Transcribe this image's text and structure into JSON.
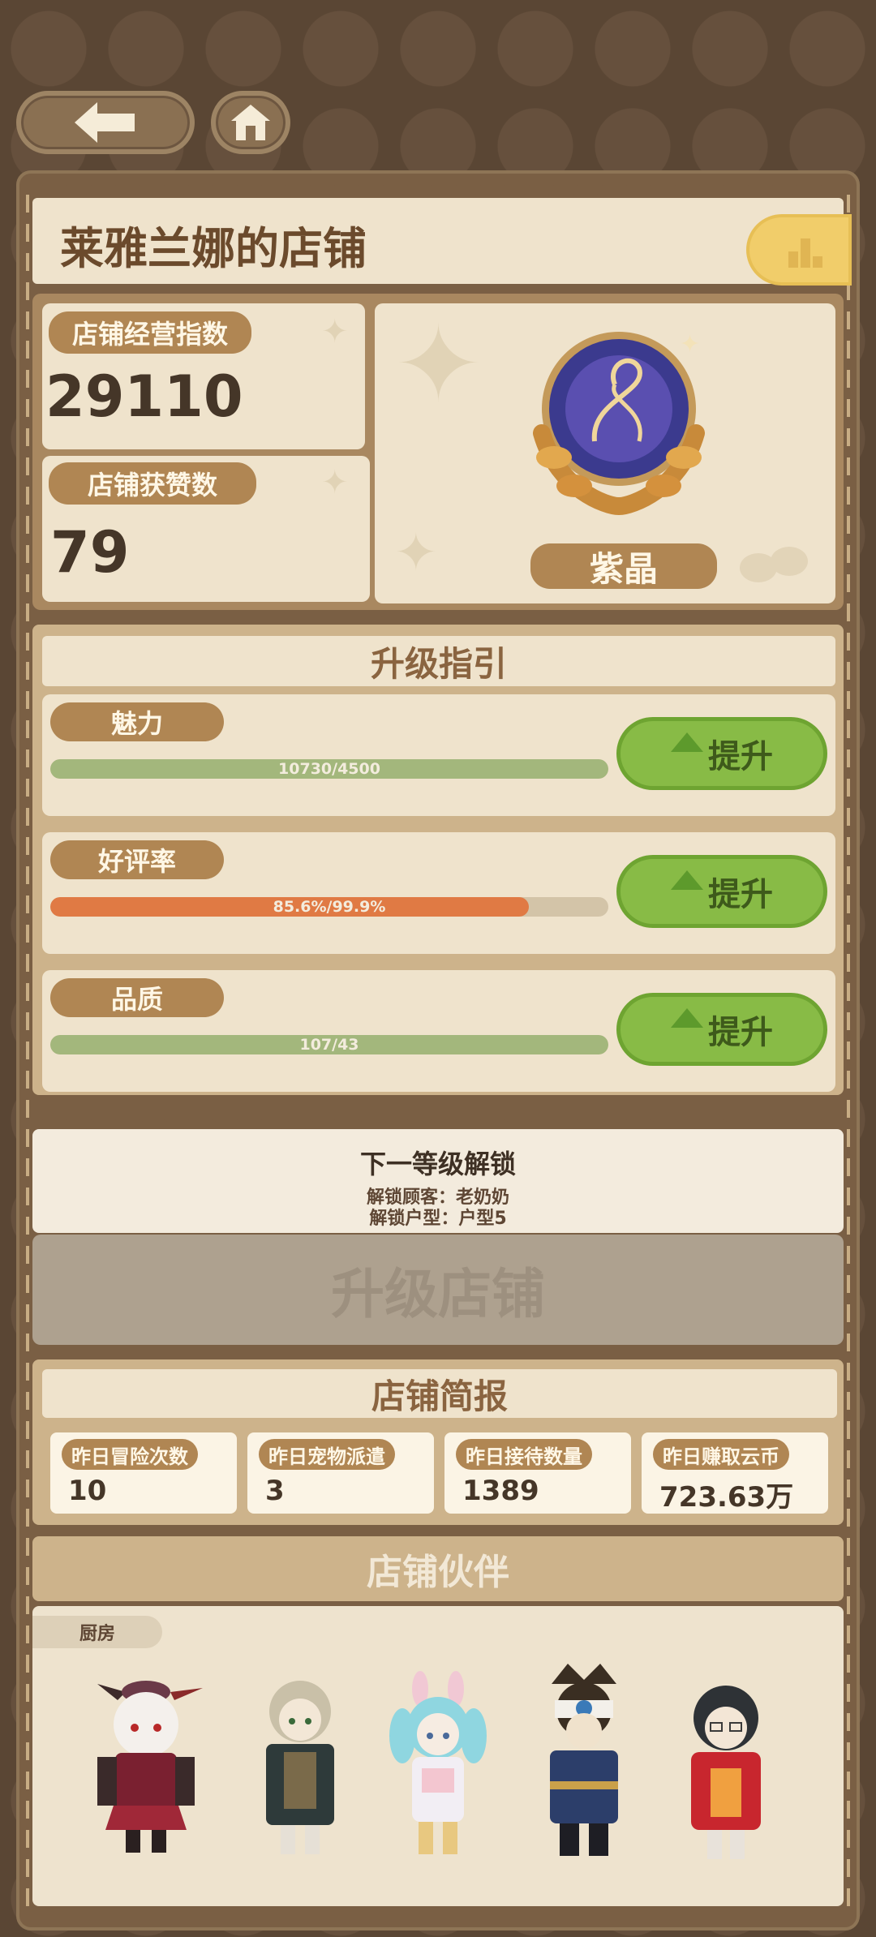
{
  "nav": {
    "back_icon": "back-arrow-icon",
    "home_icon": "home-icon"
  },
  "store": {
    "title": "莱雅兰娜的店铺",
    "rank_icon": "bar-chart-icon"
  },
  "metrics": {
    "operation_label": "店铺经营指数",
    "operation_value": "29110",
    "likes_label": "店铺获赞数",
    "likes_value": "79"
  },
  "badge": {
    "tier": "紫晶",
    "icon": "amethyst-laurel-emblem-icon"
  },
  "upgrade_guide": {
    "title": "升级指引",
    "rows": [
      {
        "label": "魅力",
        "text": "10730/4500",
        "progress": 1.0,
        "color": "#a3b77c",
        "button": "提升"
      },
      {
        "label": "好评率",
        "text": "85.6%/99.9%",
        "progress": 0.857,
        "color": "#e07a44",
        "button": "提升"
      },
      {
        "label": "品质",
        "text": "107/43",
        "progress": 1.0,
        "color": "#a3b77c",
        "button": "提升"
      }
    ]
  },
  "next_level": {
    "title": "下一等级解锁",
    "line1": "解锁顾客：老奶奶",
    "line2": "解锁户型：户型5",
    "upgrade_button": "升级店铺"
  },
  "report": {
    "title": "店铺简报",
    "items": [
      {
        "label": "昨日冒险次数",
        "value": "10"
      },
      {
        "label": "昨日宠物派遣",
        "value": "3"
      },
      {
        "label": "昨日接待数量",
        "value": "1389"
      },
      {
        "label": "昨日赚取云币",
        "value": "723.63万"
      }
    ]
  },
  "partners": {
    "title": "店铺伙伴",
    "room_tag": "厨房",
    "characters": [
      "horned-girl-icon",
      "cloaked-boy-icon",
      "bunny-girl-icon",
      "captain-icon",
      "red-coat-girl-icon"
    ]
  },
  "colors": {
    "accent_green": "#88bb46",
    "bar_orange": "#e07a44",
    "bar_green": "#a3b77c",
    "brown": "#b08653"
  }
}
